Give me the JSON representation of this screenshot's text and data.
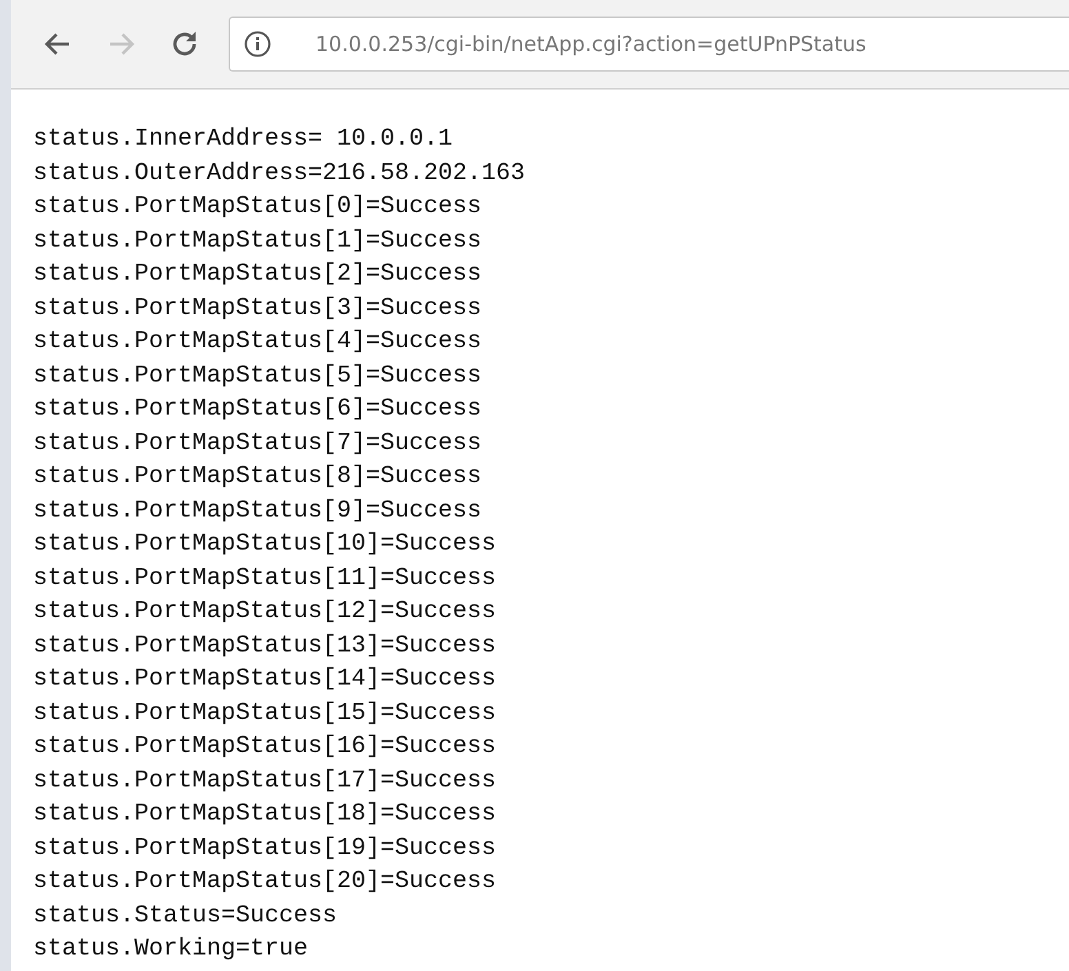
{
  "toolbar": {
    "nav_buttons": [
      {
        "kind": "back",
        "disabled": false
      },
      {
        "kind": "forward",
        "disabled": true
      },
      {
        "kind": "reload",
        "disabled": false
      }
    ],
    "address": "10.0.0.253/cgi-bin/netApp.cgi?action=getUPnPStatus"
  },
  "lines": [
    "status.InnerAddress= 10.0.0.1",
    "status.OuterAddress=216.58.202.163",
    "status.PortMapStatus[0]=Success",
    "status.PortMapStatus[1]=Success",
    "status.PortMapStatus[2]=Success",
    "status.PortMapStatus[3]=Success",
    "status.PortMapStatus[4]=Success",
    "status.PortMapStatus[5]=Success",
    "status.PortMapStatus[6]=Success",
    "status.PortMapStatus[7]=Success",
    "status.PortMapStatus[8]=Success",
    "status.PortMapStatus[9]=Success",
    "status.PortMapStatus[10]=Success",
    "status.PortMapStatus[11]=Success",
    "status.PortMapStatus[12]=Success",
    "status.PortMapStatus[13]=Success",
    "status.PortMapStatus[14]=Success",
    "status.PortMapStatus[15]=Success",
    "status.PortMapStatus[16]=Success",
    "status.PortMapStatus[17]=Success",
    "status.PortMapStatus[18]=Success",
    "status.PortMapStatus[19]=Success",
    "status.PortMapStatus[20]=Success",
    "status.Status=Success",
    "status.Working=true"
  ]
}
